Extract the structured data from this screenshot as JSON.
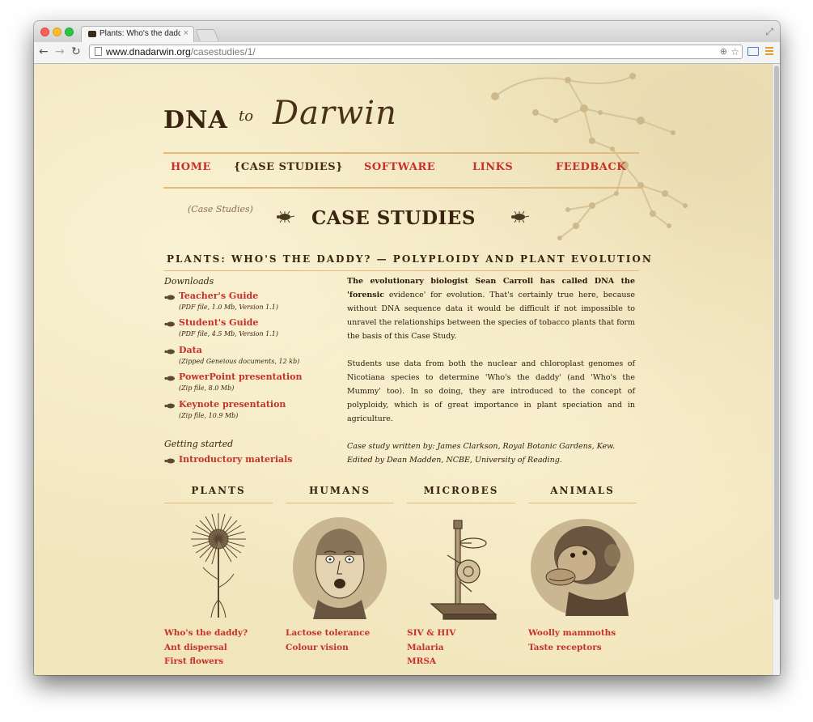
{
  "browser": {
    "tab_title": "Plants: Who's the daddy? -",
    "tab_close": "×",
    "url_domain": "www.dnadarwin.org",
    "url_path": "/casestudies/1/"
  },
  "logo": {
    "dna": "DNA",
    "to": "to",
    "darwin": "Darwin"
  },
  "nav": {
    "items": [
      {
        "label": "HOME"
      },
      {
        "label": "{CASE STUDIES}"
      },
      {
        "label": "SOFTWARE"
      },
      {
        "label": "LINKS"
      },
      {
        "label": "FEEDBACK"
      }
    ]
  },
  "section": {
    "script_label": "(Case Studies)",
    "title": "CASE STUDIES",
    "subtitle": "PLANTS: WHO'S THE DADDY? — POLYPLOIDY AND PLANT EVOLUTION"
  },
  "downloads": {
    "heading": "Downloads",
    "items": [
      {
        "label": "Teacher's Guide",
        "meta": "(PDF file, 1.0 Mb, Version 1.1)"
      },
      {
        "label": "Student's Guide",
        "meta": "(PDF file, 4.5 Mb, Version 1.1)"
      },
      {
        "label": "Data",
        "meta": "(Zipped Geneious documents, 12 kb)"
      },
      {
        "label": "PowerPoint presentation",
        "meta": "(Zip file, 8.0 Mb)"
      },
      {
        "label": "Keynote presentation",
        "meta": "(Zip file, 10.9 Mb)"
      }
    ],
    "getting_started_heading": "Getting started",
    "intro_materials": "Introductory materials"
  },
  "intro": {
    "p1_bold": "The evolutionary biologist Sean Carroll has called DNA the 'forensic",
    "p1_rest": "evidence' for evolution. That's certainly true here, because without DNA sequence data it would be difficult if not impossible to unravel the relationships between the species of tobacco plants that form the basis of this Case Study.",
    "p2": "Students use data from both the nuclear and chloroplast genomes of Nicotiana species to determine 'Who's the daddy' (and 'Who's the Mummy' too). In so doing, they are introduced to the concept of polyploidy, which is of great importance in plant speciation and in agriculture.",
    "credit1": "Case study written by: James Clarkson, Royal Botanic Gardens, Kew.",
    "credit2": "Edited by Dean Madden, NCBE, University of Reading."
  },
  "categories": [
    {
      "title": "PLANTS",
      "image": "dandelion-engraving",
      "links": [
        "Who's the daddy?",
        "Ant dispersal",
        "First flowers"
      ]
    },
    {
      "title": "HUMANS",
      "image": "shocked-man-engraving",
      "links": [
        "Lactose tolerance",
        "Colour vision"
      ]
    },
    {
      "title": "MICROBES",
      "image": "microscope-engraving",
      "links": [
        "SIV & HIV",
        "Malaria",
        "MRSA"
      ]
    },
    {
      "title": "ANIMALS",
      "image": "chimpanzee-engraving",
      "links": [
        "Woolly mammoths",
        "Taste receptors"
      ]
    }
  ],
  "colors": {
    "link_red": "#c8302a",
    "ink_brown": "#3a2410",
    "parchment": "#f1e5bc",
    "rule_orange": "#e4b97a"
  }
}
